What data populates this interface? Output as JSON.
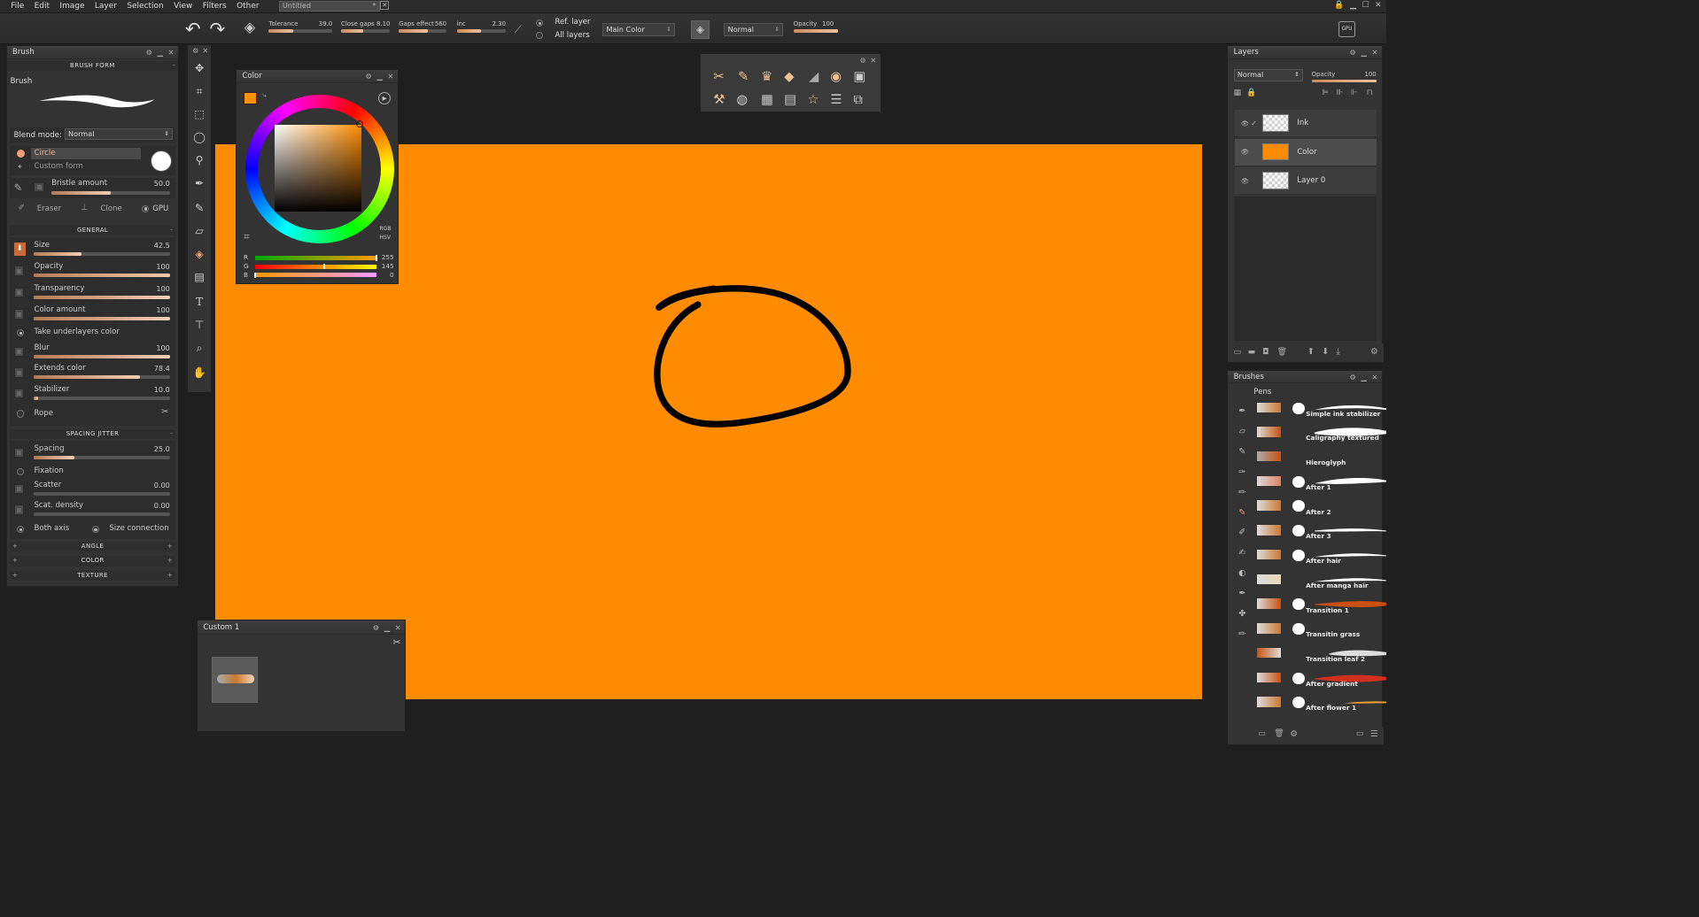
{
  "menu": [
    "File",
    "Edit",
    "Image",
    "Layer",
    "Selection",
    "View",
    "Filters",
    "Other"
  ],
  "doc_tab": "Untitled",
  "doc_tab_mark": "*",
  "toolbar": {
    "tolerance_label": "Tolerance",
    "tolerance_val": "39.0",
    "tolerance_level": 0.39,
    "closegaps_label": "Close gaps",
    "closegaps_val": "8.10",
    "closegaps_level": 0.45,
    "gapseffect_label": "Gaps effect",
    "gapseffect_val": "560",
    "gapseffect_level": 0.6,
    "inc_label": "inc",
    "inc_val": "2.30",
    "inc_level": 0.5,
    "ref_layer": "Ref. layer",
    "all_layers": "All layers",
    "main_color": "Main Color",
    "blend": "Normal",
    "opacity_label": "Opacity",
    "opacity_val": "100",
    "opacity_level": 1.0,
    "gpu": "GPU"
  },
  "brush_panel": {
    "title": "Brush",
    "brush_form": "BRUSH FORM",
    "brush_label": "Brush",
    "blend_label": "Blend mode:",
    "blend_value": "Normal",
    "circle": "Circle",
    "custom_form": "Custom form",
    "bristle_label": "Bristle amount",
    "bristle_val": "50.0",
    "bristle_level": 0.5,
    "eraser": "Eraser",
    "clone": "Clone",
    "gpu": "GPU",
    "general": "GENERAL",
    "size_label": "Size",
    "size_val": "42.5",
    "size_level": 0.35,
    "opacity_label": "Opacity",
    "opacity_val": "100",
    "opacity_level": 1.0,
    "transparency_label": "Transparency",
    "transparency_val": "100",
    "transparency_level": 1.0,
    "coloramount_label": "Color amount",
    "coloramount_val": "100",
    "coloramount_level": 1.0,
    "take_underlayers": "Take underlayers color",
    "blur_label": "Blur",
    "blur_val": "100",
    "blur_level": 1.0,
    "extends_label": "Extends color",
    "extends_val": "78.4",
    "extends_level": 0.78,
    "stabilizer_label": "Stabilizer",
    "stabilizer_val": "10.0",
    "stabilizer_level": 0.03,
    "rope": "Rope",
    "spacing_jitter": "SPACING JITTER",
    "spacing_label": "Spacing",
    "spacing_val": "25.0",
    "spacing_level": 0.3,
    "fixation": "Fixation",
    "scatter_label": "Scatter",
    "scatter_val": "0.00",
    "scatter_level": 0.0,
    "scatdensity_label": "Scat. density",
    "scatdensity_val": "0.00",
    "scatdensity_level": 0.0,
    "both_axis": "Both axis",
    "size_connection": "Size connection",
    "angle": "ANGLE",
    "color": "COLOR",
    "texture": "TEXTURE"
  },
  "color_panel": {
    "title": "Color",
    "rgb": "RGB",
    "hsv": "HSV",
    "r_label": "R",
    "r_val": "255",
    "r_level": 1.0,
    "g_label": "G",
    "g_val": "145",
    "g_level": 0.57,
    "b_label": "B",
    "b_val": "0",
    "b_level": 0.0,
    "current_color": "#ff9100"
  },
  "custom_panel": {
    "title": "Custom 1"
  },
  "layers_panel": {
    "title": "Layers",
    "blend": "Normal",
    "opacity_label": "Opacity",
    "opacity_val": "100",
    "opacity_level": 1.0,
    "layers": [
      {
        "name": "Ink",
        "checked": "✓"
      },
      {
        "name": "Color"
      },
      {
        "name": "Layer 0"
      }
    ]
  },
  "brushes_panel": {
    "title": "Brushes",
    "category": "Pens",
    "items": [
      "Simple ink stabilizer",
      "Caligraphy textured",
      "Hieroglyph",
      "After 1",
      "After 2",
      "After 3",
      "After hair",
      "After manga hair",
      "Transition 1",
      "Transitin grass",
      "Transition leaf 2",
      "After gradient",
      "After flower 1"
    ]
  },
  "colors": {
    "canvas": "#ff8c00",
    "accent": "#ff9100"
  }
}
